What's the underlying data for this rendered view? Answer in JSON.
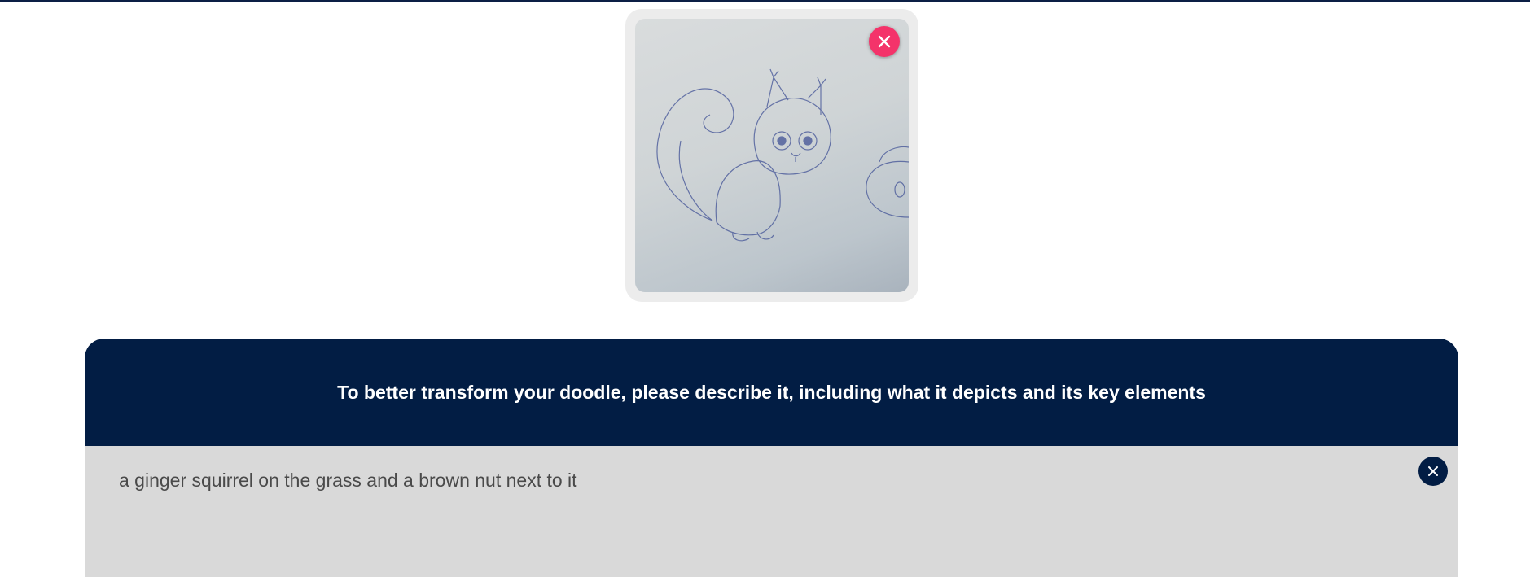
{
  "upload": {
    "image_alt": "Uploaded doodle: pencil sketch of a squirrel with an acorn",
    "remove_icon": "close-icon",
    "remove_color": "#f4336a"
  },
  "prompt": {
    "instruction": "To better transform your doodle, please describe it, including what it depicts and its key elements",
    "description_value": "a ginger squirrel on the grass and a brown nut next to it",
    "clear_icon": "close-icon",
    "header_color": "#021d44",
    "body_color": "#d9d9d9"
  }
}
